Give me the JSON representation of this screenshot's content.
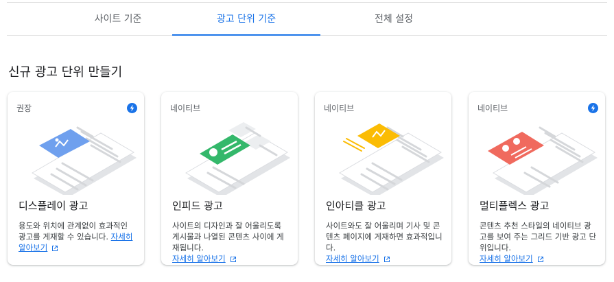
{
  "tabs": [
    {
      "label": "사이트 기준",
      "active": false
    },
    {
      "label": "광고 단위 기준",
      "active": true
    },
    {
      "label": "전체 설정",
      "active": false
    }
  ],
  "section_title": "신규 광고 단위 만들기",
  "colors": {
    "accent": "#1a73e8",
    "display": "#6fa0ee",
    "infeed": "#34b86b",
    "inarticle": "#fbbc04",
    "multiplex": "#f06a5e"
  },
  "cards": [
    {
      "tag": "권장",
      "title": "디스플레이 광고",
      "description": "용도와 위치에 관계없이 효과적인 광고를 게재할 수 있습니다.",
      "link": "자세히 알아보기",
      "bolt_icon": true
    },
    {
      "tag": "네이티브",
      "title": "인피드 광고",
      "description": "사이트의 디자인과 잘 어울리도록 게시물과 나열된 콘텐츠 사이에 게재됩니다.",
      "link": "자세히 알아보기",
      "bolt_icon": false
    },
    {
      "tag": "네이티브",
      "title": "인아티클 광고",
      "description": "사이트와도 잘 어울리며 기사 및 콘텐츠 페이지에 게재하면 효과적입니다.",
      "link": "자세히 알아보기",
      "bolt_icon": false
    },
    {
      "tag": "네이티브",
      "title": "멀티플렉스 광고",
      "description": "콘텐츠 추천 스타일의 네이티브 광고를 보여 주는 그리드 기반 광고 단위입니다.",
      "link": "자세히 알아보기",
      "bolt_icon": true
    }
  ]
}
